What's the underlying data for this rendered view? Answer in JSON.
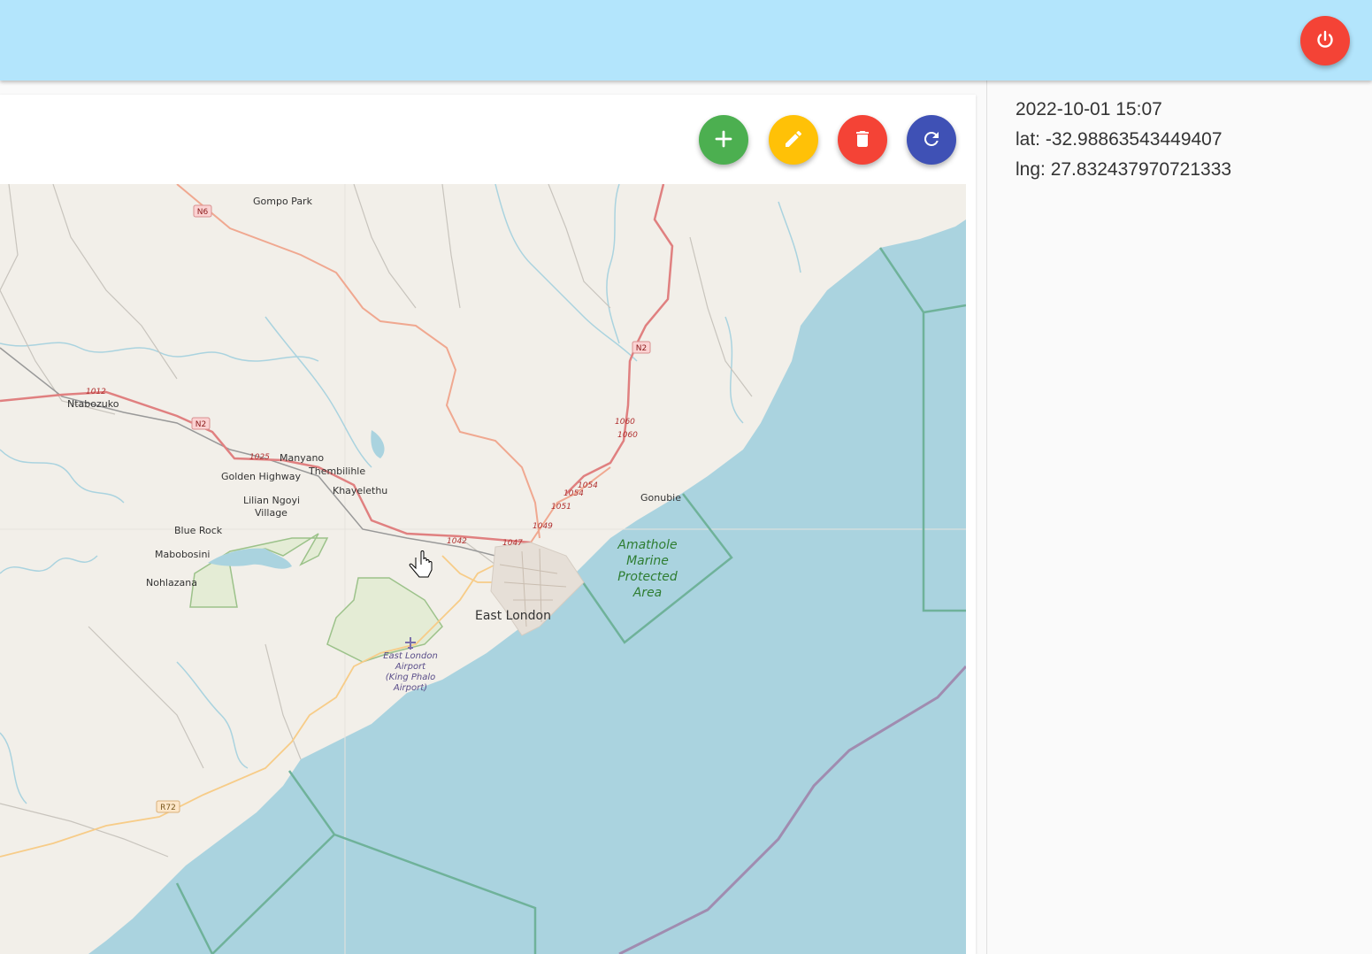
{
  "header": {
    "power_button": {
      "icon": "power-icon",
      "color": "#f44336"
    }
  },
  "toolbar": {
    "add_button": {
      "icon": "plus-icon",
      "color": "#4caf50"
    },
    "edit_button": {
      "icon": "pencil-icon",
      "color": "#ffc107"
    },
    "delete_button": {
      "icon": "trash-icon",
      "color": "#f44336"
    },
    "refresh_button": {
      "icon": "refresh-icon",
      "color": "#3f51b5"
    }
  },
  "info": {
    "datetime": "2022-10-01 15:07",
    "lat": "lat: -32.98863543449407",
    "lng": "lng: 27.832437970721333"
  },
  "map": {
    "land_color": "#f2efe9",
    "water_color": "#aad3df",
    "places": {
      "gompo_park": "Gompo Park",
      "ntabozuko": "Ntabozuko",
      "manyano": "Manyano",
      "thembilihle": "Thembilihle",
      "golden_highway": "Golden Highway",
      "khayelethu": "Khayelethu",
      "lilian_ngoyi": "Lilian Ngoyi",
      "village": "Village",
      "blue_rock": "Blue Rock",
      "mabobosini": "Mabobosini",
      "nohlazana": "Nohlazana",
      "gonubie": "Gonubie",
      "east_london": "East London"
    },
    "protected_area": [
      "Amathole",
      "Marine",
      "Protected",
      "Area"
    ],
    "airport": [
      "East London",
      "Airport",
      "(King Phalo",
      "Airport)"
    ],
    "shields": {
      "n6": "N6",
      "n2_north": "N2",
      "n2_west": "N2",
      "r72": "R72"
    },
    "route_numbers": {
      "r1012": "1012",
      "r1025": "1025",
      "r1042": "1042",
      "r1047": "1047",
      "r1049": "1049",
      "r1051": "1051",
      "r1054a": "1054",
      "r1054b": "1054",
      "r1060a": "1060",
      "r1060b": "1060"
    }
  }
}
